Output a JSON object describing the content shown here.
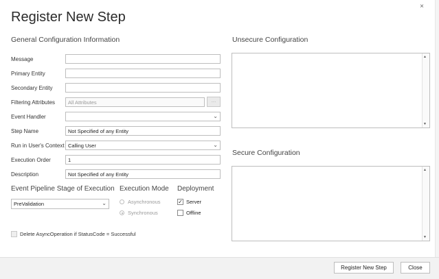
{
  "dialog": {
    "title": "Register New Step",
    "close_glyph": "×"
  },
  "general": {
    "heading": "General Configuration Information",
    "fields": [
      {
        "label": "Message",
        "value": ""
      },
      {
        "label": "Primary Entity",
        "value": ""
      },
      {
        "label": "Secondary Entity",
        "value": ""
      },
      {
        "label": "Filtering Attributes",
        "value": "All Attributes",
        "button": "…"
      },
      {
        "label": "Event Handler",
        "value": ""
      },
      {
        "label": "Step Name",
        "value": "Not Specified of any Entity"
      },
      {
        "label": "Run in User's Context",
        "value": "Calling User"
      },
      {
        "label": "Execution Order",
        "value": "1"
      },
      {
        "label": "Description",
        "value": "Not Specified of any Entity"
      }
    ]
  },
  "pipeline": {
    "heading": "Event Pipeline Stage of Execution",
    "selected": "PreValidation"
  },
  "execution_mode": {
    "heading": "Execution Mode",
    "options": [
      "Asynchronous",
      "Synchronous"
    ],
    "selected": "Synchronous"
  },
  "deployment": {
    "heading": "Deployment",
    "options": [
      {
        "label": "Server",
        "checked": true
      },
      {
        "label": "Offline",
        "checked": false
      }
    ]
  },
  "delete_async": {
    "label": "Delete AsyncOperation if StatusCode = Successful",
    "checked": false
  },
  "unsecure": {
    "heading": "Unsecure  Configuration"
  },
  "secure": {
    "heading": "Secure  Configuration"
  },
  "footer": {
    "register_label": "Register New Step",
    "close_label": "Close"
  },
  "icons": {
    "check_glyph": "✓",
    "chevron": "⌄",
    "scroll_up": "▲",
    "scroll_down": "▼"
  },
  "colors": {
    "footer_bg": "#f2f2f2",
    "border": "#bdbdbd"
  }
}
